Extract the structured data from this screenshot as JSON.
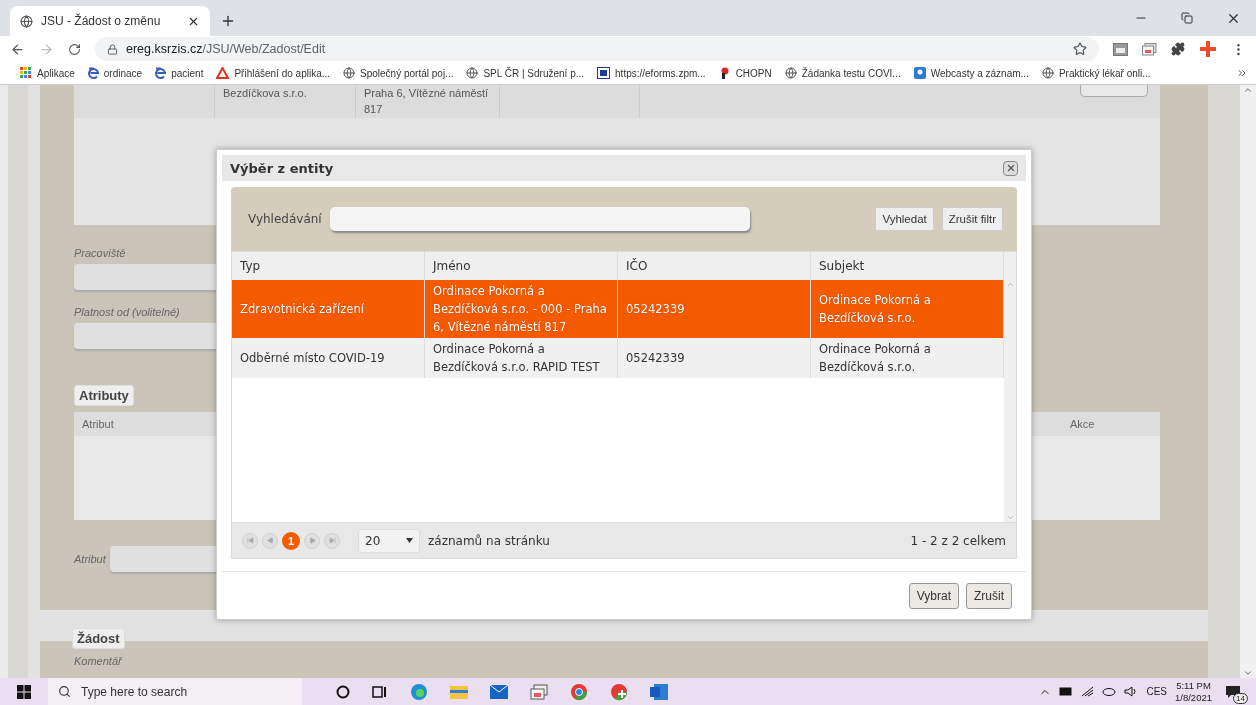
{
  "browser": {
    "tab": {
      "title": "JSU - Žádost o změnu",
      "selected": true
    },
    "url_host": "ereg.ksrzis.cz",
    "url_path": "/JSU/Web/Zadost/Edit",
    "bookmarks": [
      {
        "kind": "apps",
        "label": "Aplikace"
      },
      {
        "kind": "edge",
        "label": "ordinace"
      },
      {
        "kind": "edge",
        "label": "pacient"
      },
      {
        "kind": "acrobat",
        "label": "Přihlášení do aplika..."
      },
      {
        "kind": "globe",
        "label": "Společný portál poj..."
      },
      {
        "kind": "globe",
        "label": "SPL ČR | Sdružení p..."
      },
      {
        "kind": "zp",
        "label": "https://eforms.zpm..."
      },
      {
        "kind": "chopn",
        "label": "CHOPN"
      },
      {
        "kind": "globe",
        "label": "Žádanka testu COVI..."
      },
      {
        "kind": "webcast",
        "label": "Webcasty a záznam..."
      },
      {
        "kind": "globe",
        "label": "Praktický lékař onli..."
      }
    ]
  },
  "page": {
    "top_row": [
      "Bezdíčkova s.r.o.",
      "Praha 6, Vítězné náměstí 817"
    ],
    "fields": [
      {
        "label": "Pracoviště"
      },
      {
        "label": "Platnost od (volitelné)"
      }
    ],
    "attributes": {
      "legend": "Atributy",
      "columns": [
        "Atribut",
        "Akce"
      ],
      "field_label": "Atribut"
    },
    "request": {
      "legend": "Žádost",
      "field_label": "Komentář"
    }
  },
  "dialog": {
    "title": "Výběr z entity",
    "search_label": "Vyhledávání",
    "search_buttons": [
      "Vyhledat",
      "Zrušit filtr"
    ],
    "columns": [
      "Typ",
      "Jméno",
      "IČO",
      "Subjekt"
    ],
    "rows": [
      {
        "selected": true,
        "cells": [
          "Zdravotnická zařízení",
          "Ordinace Pokorná a Bezdíčková s.r.o. - 000 - Praha 6, Vítězné náměstí 817",
          "05242339",
          "Ordinace Pokorná a Bezdíčková s.r.o."
        ]
      },
      {
        "selected": false,
        "cells": [
          "Odběrné místo COVID-19",
          "Ordinace Pokorná a Bezdíčková s.r.o. RAPID TEST",
          "05242339",
          "Ordinace Pokorná a Bezdíčková s.r.o."
        ]
      }
    ],
    "pages": [
      {
        "label": "1",
        "selected": true
      }
    ],
    "page_size": "20",
    "page_size_label": "záznamů na stránku",
    "summary": "1 - 2 z 2 celkem",
    "buttons": [
      "Vybrat",
      "Zrušit"
    ]
  },
  "taskbar": {
    "search_placeholder": "Type here to search",
    "language": "CES",
    "time": "5:11 PM",
    "date": "1/8/2021",
    "notifications": "14"
  }
}
